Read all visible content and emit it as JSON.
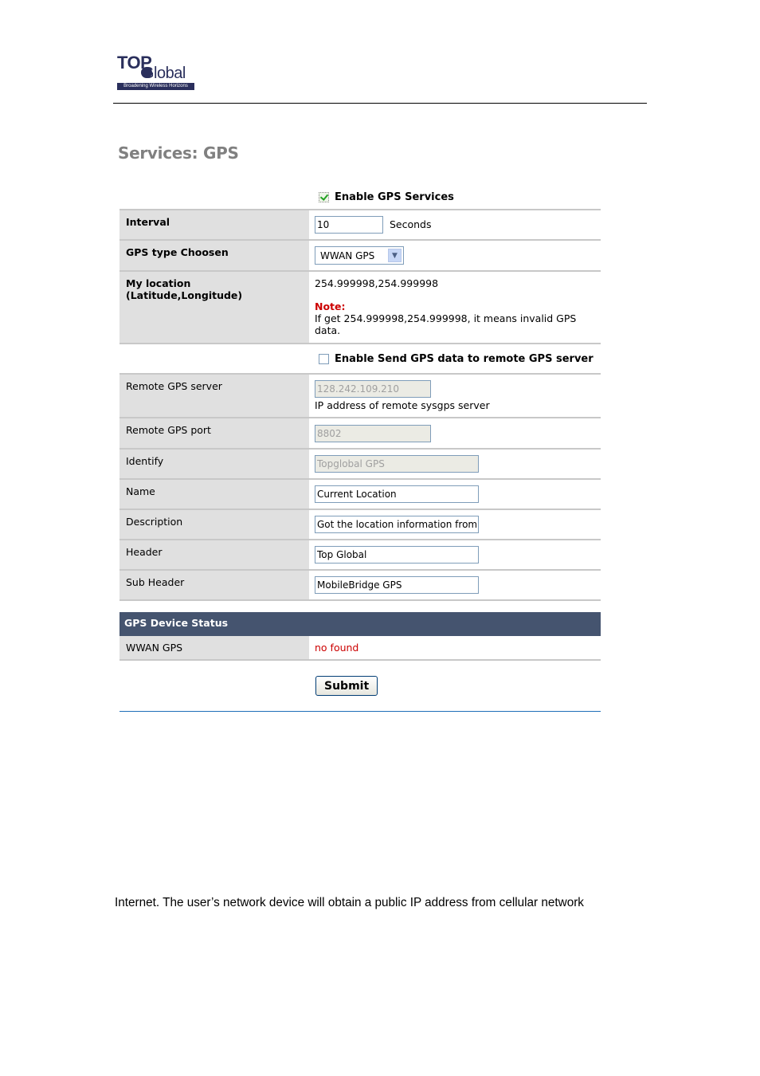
{
  "logo": {
    "top": "TOP",
    "global": "Global",
    "tagline": "Broadening Wireless Horizons"
  },
  "page_title": "Services: GPS",
  "enable_gps": {
    "label": "Enable GPS Services",
    "checked": true
  },
  "interval": {
    "label": "Interval",
    "value": "10",
    "unit": "Seconds"
  },
  "gps_type": {
    "label": "GPS type Choosen",
    "selected": "WWAN GPS"
  },
  "location": {
    "label_line1": "My location",
    "label_line2": "(Latitude,Longitude)",
    "value": "254.999998,254.999998",
    "note_label": "Note:",
    "note_text": "If get 254.999998,254.999998, it means invalid GPS data."
  },
  "enable_remote": {
    "label": "Enable Send GPS data to remote GPS server",
    "checked": false
  },
  "remote_server": {
    "label": "Remote GPS server",
    "value": "128.242.109.210",
    "hint": "IP address of remote sysgps server"
  },
  "remote_port": {
    "label": "Remote GPS port",
    "value": "8802"
  },
  "identify": {
    "label": "Identify",
    "value": "Topglobal GPS"
  },
  "name": {
    "label": "Name",
    "value": "Current Location"
  },
  "description": {
    "label": "Description",
    "value": "Got the location information from th"
  },
  "header": {
    "label": "Header",
    "value": "Top Global"
  },
  "sub_header": {
    "label": "Sub Header",
    "value": "MobileBridge GPS"
  },
  "device_status": {
    "title": "GPS Device Status",
    "rows": [
      {
        "label": "WWAN GPS",
        "value": "no found"
      }
    ]
  },
  "submit_label": "Submit",
  "body_text": "Internet. The user’s network device will obtain a public IP address from cellular network"
}
